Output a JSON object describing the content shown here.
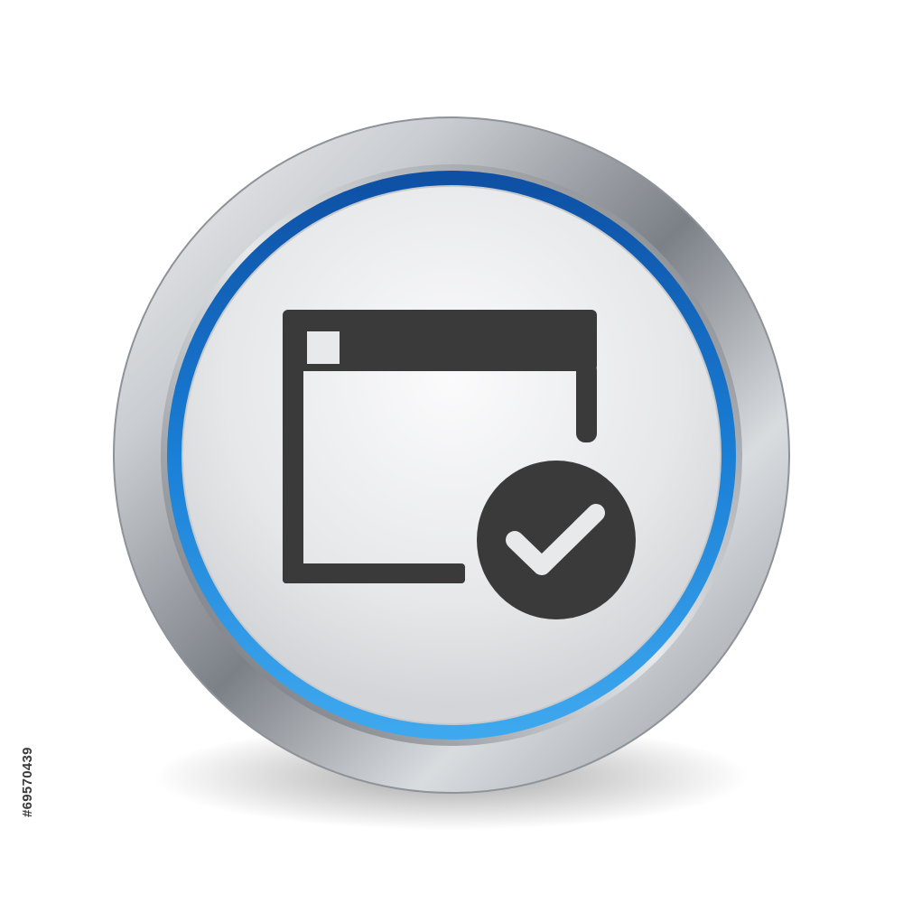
{
  "stock_id": "#69570439",
  "icon": {
    "name": "window-check-icon",
    "glyph_color": "#3a3a3a",
    "accent_ring_color": "#1a7fd6",
    "bezel_color": "#9ea3a8"
  }
}
